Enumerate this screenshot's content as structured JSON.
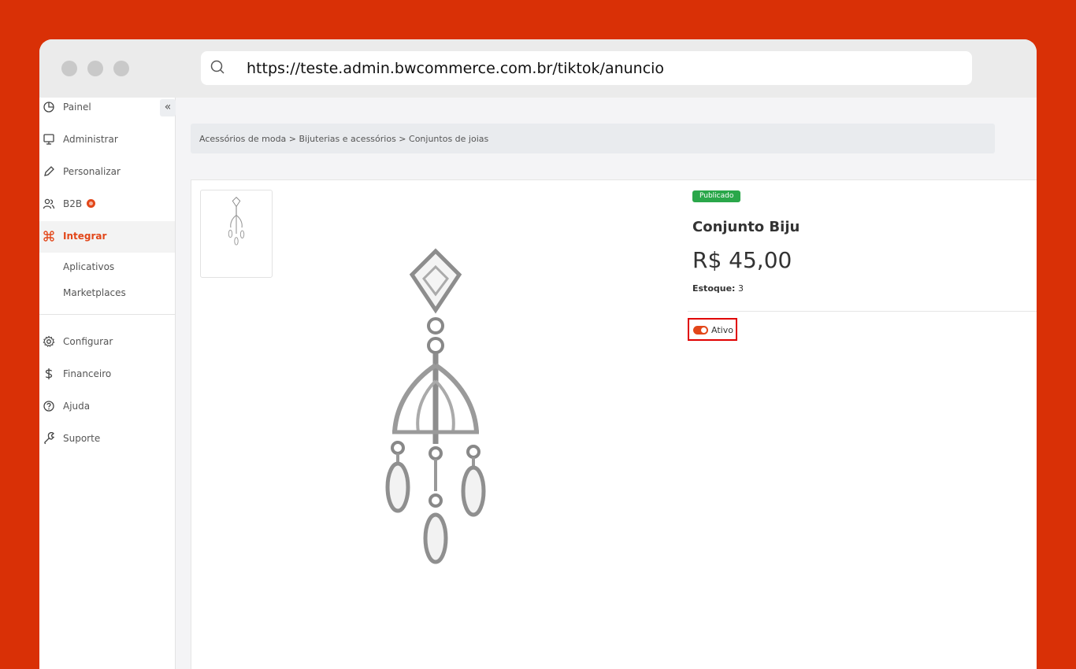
{
  "browser": {
    "url": "https://teste.admin.bwcommerce.com.br/tiktok/anuncio",
    "dots": [
      "close",
      "minimize",
      "maximize"
    ]
  },
  "sidebar": {
    "collapse_label": "«",
    "items": [
      {
        "label": "Painel",
        "icon": "pie-chart-icon"
      },
      {
        "label": "Administrar",
        "icon": "monitor-icon"
      },
      {
        "label": "Personalizar",
        "icon": "pencil-icon"
      },
      {
        "label": "B2B",
        "icon": "users-icon"
      },
      {
        "label": "Integrar",
        "icon": "command-icon"
      },
      {
        "label": "Configurar",
        "icon": "gear-icon"
      },
      {
        "label": "Financeiro",
        "icon": "dollar-icon"
      },
      {
        "label": "Ajuda",
        "icon": "help-circle-icon"
      },
      {
        "label": "Suporte",
        "icon": "wrench-icon"
      }
    ],
    "sub_items": [
      "Aplicativos",
      "Marketplaces"
    ],
    "accent_color": "#e2471a"
  },
  "breadcrumb": "Acessórios de moda > Bijuterias e acessórios > Conjuntos de joias",
  "product": {
    "status": "Publicado",
    "name": "Conjunto Biju",
    "price": "R$ 45,00",
    "stock_label": "Estoque:",
    "stock_value": "3",
    "active_label": "Ativo",
    "active": true,
    "image": "chandelier-earring-image"
  }
}
